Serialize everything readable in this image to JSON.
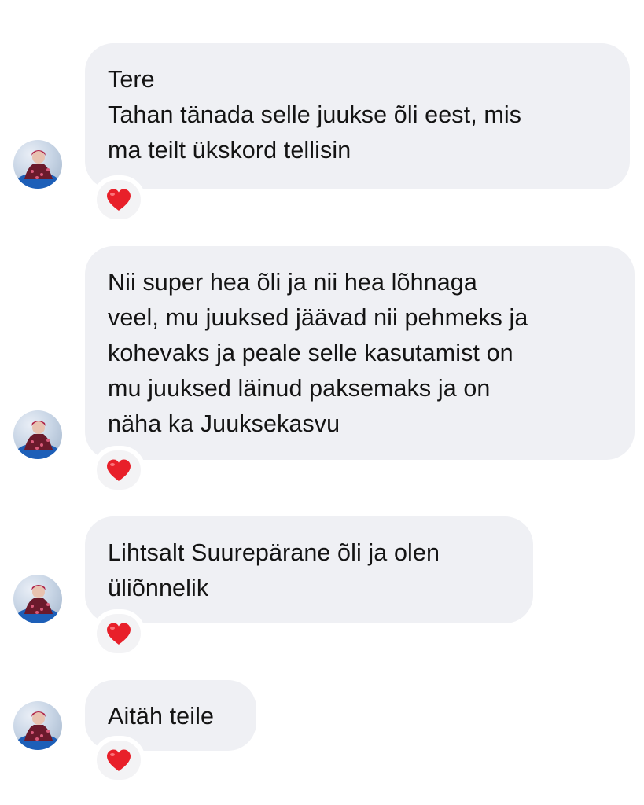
{
  "messages": [
    {
      "lines": [
        "Tere",
        "Tahan tänada selle juukse õli eest, mis",
        "ma teilt ükskord tellisin"
      ],
      "reaction": "heart-icon"
    },
    {
      "lines": [
        "Nii super hea õli ja nii hea lõhnaga",
        "veel, mu juuksed jäävad nii pehmeks ja",
        "kohevaks ja peale selle kasutamist on",
        "mu juuksed läinud paksemaks ja on",
        "näha ka Juuksekasvu"
      ],
      "reaction": "heart-icon"
    },
    {
      "lines": [
        "Lihtsalt Suurepärane õli ja olen",
        "üliõnnelik"
      ],
      "reaction": "heart-icon"
    },
    {
      "lines": [
        "Aitäh teile"
      ],
      "reaction": "heart-icon"
    }
  ],
  "colors": {
    "bubble_bg": "#eff0f4",
    "text": "#141414",
    "heart": "#e8202a"
  }
}
